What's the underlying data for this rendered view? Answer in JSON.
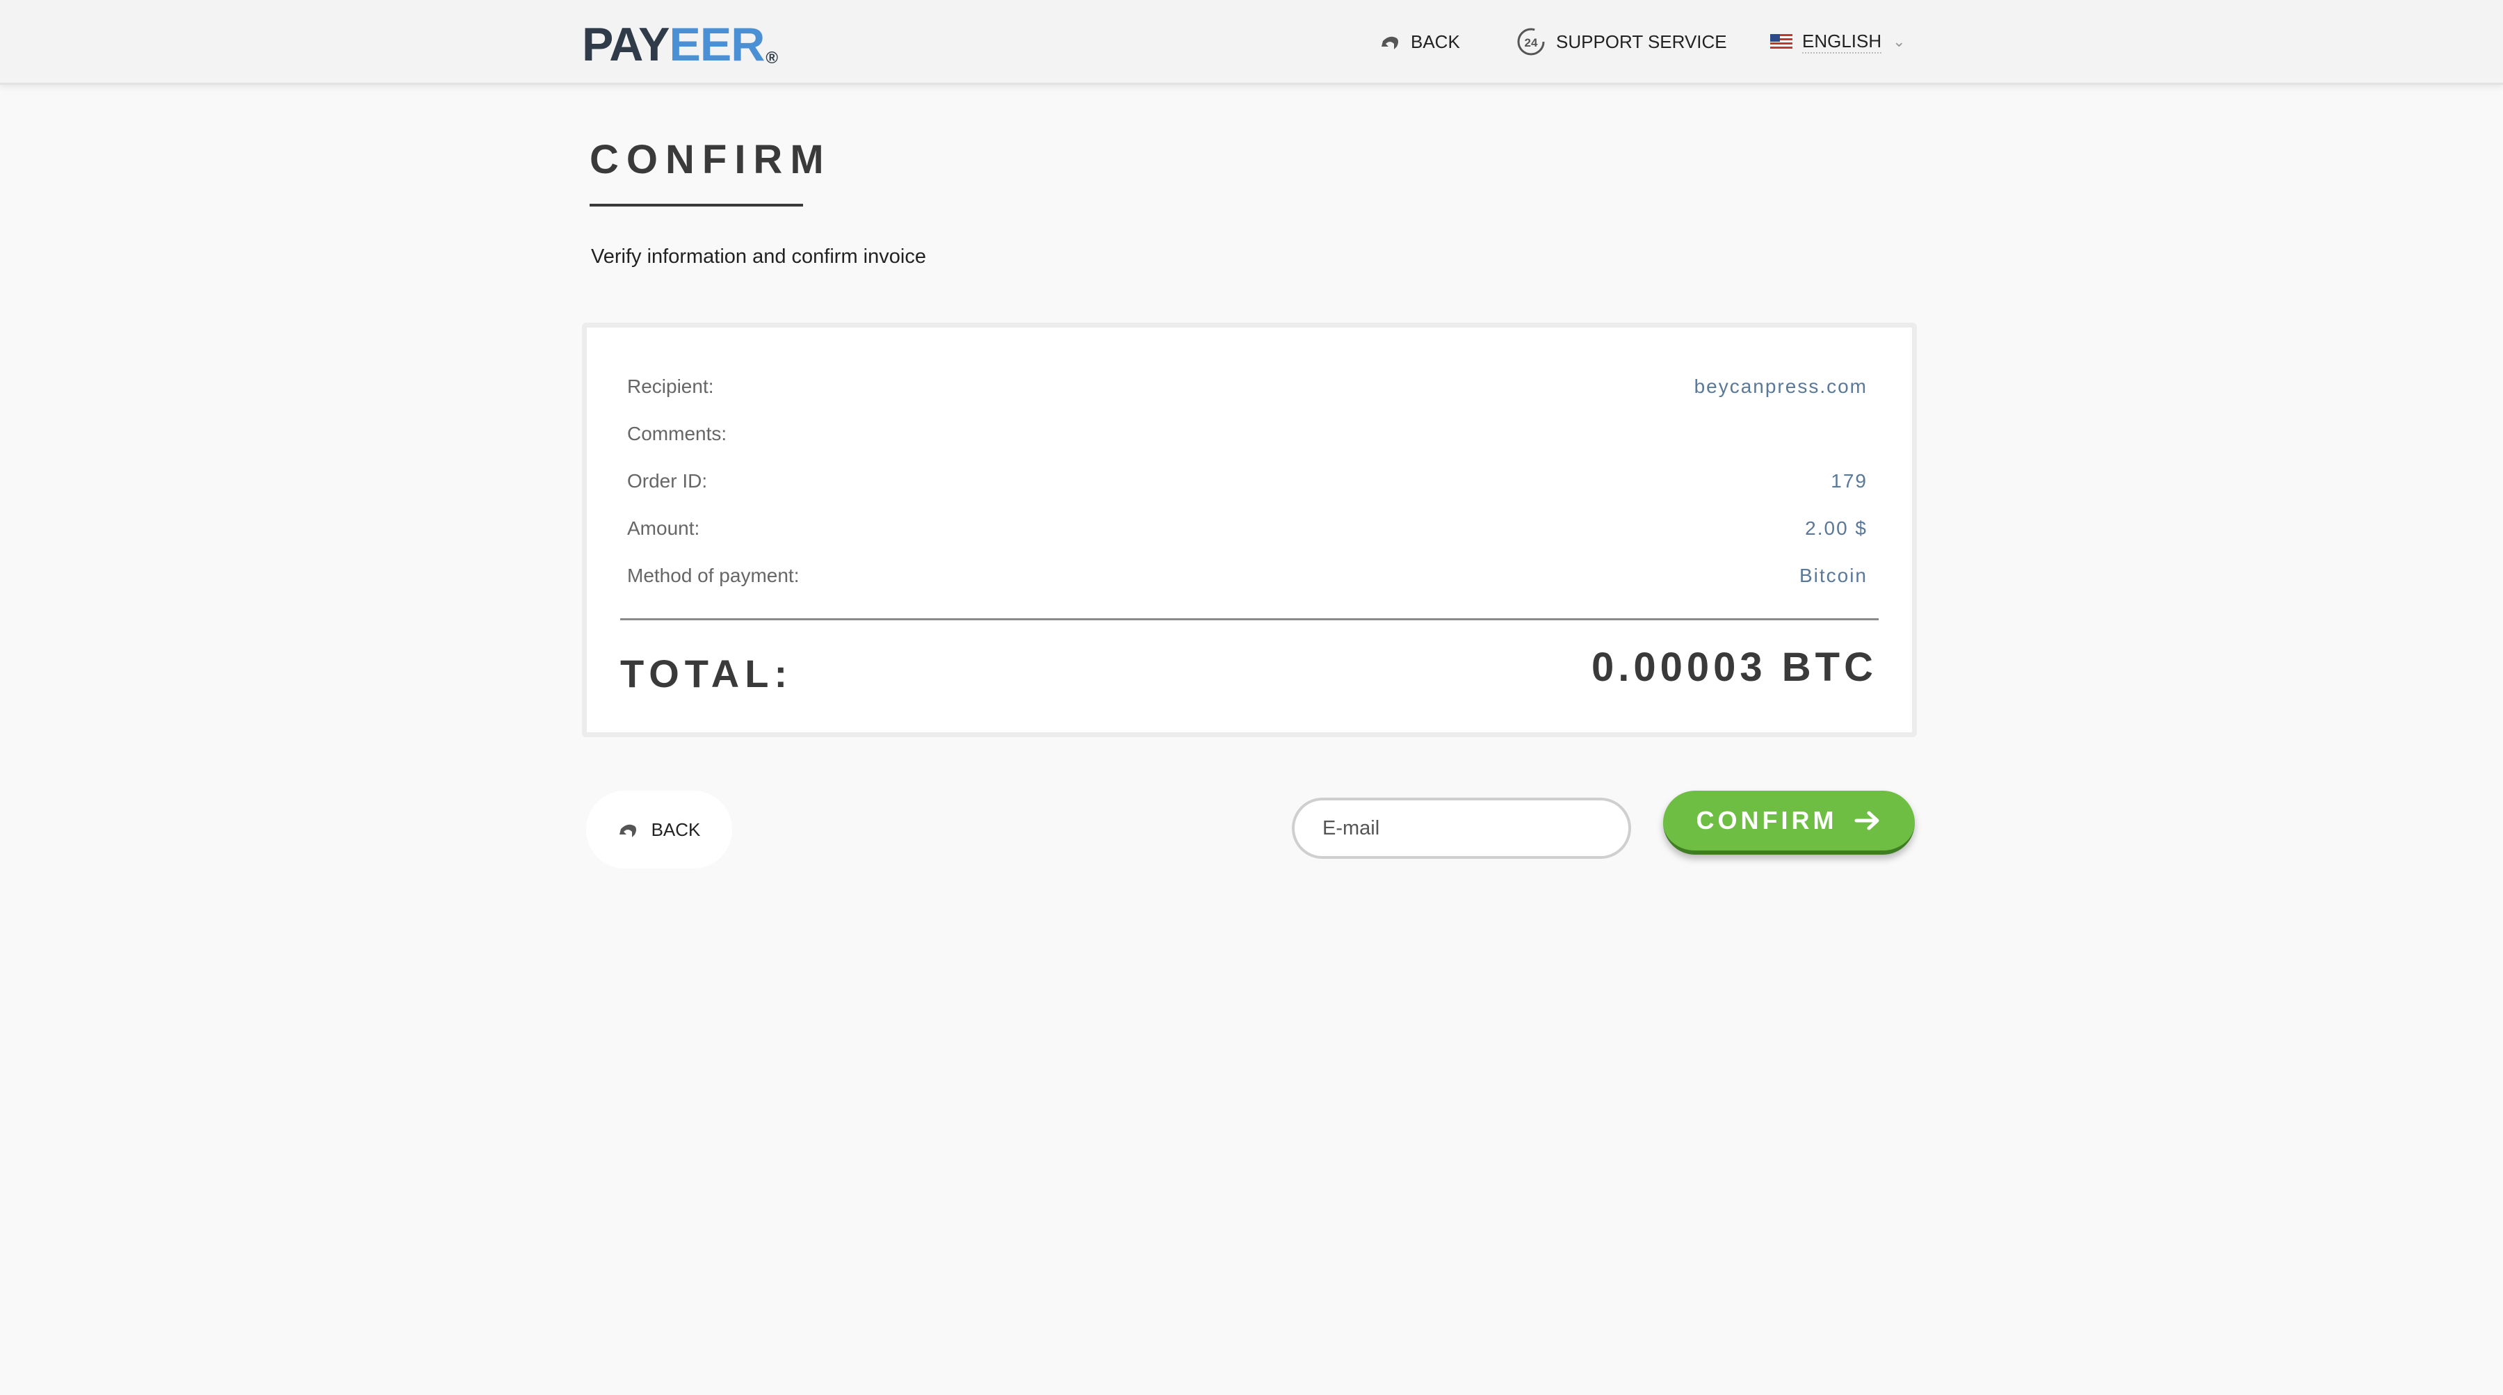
{
  "header": {
    "logo_part1": "PAY",
    "logo_part2": "EER",
    "logo_reg": "®",
    "back_label": "BACK",
    "support_label": "SUPPORT SERVICE",
    "language_label": "ENGLISH",
    "chevron": "⌄"
  },
  "page": {
    "title": "CONFIRM",
    "subtitle": "Verify information and confirm invoice"
  },
  "invoice": {
    "rows": [
      {
        "label": "Recipient:",
        "value": "beycanpress.com"
      },
      {
        "label": "Comments:",
        "value": ""
      },
      {
        "label": "Order ID:",
        "value": "179"
      },
      {
        "label": "Amount:",
        "value": "2.00 $"
      },
      {
        "label": "Method of payment:",
        "value": "Bitcoin"
      }
    ],
    "total_label": "TOTAL:",
    "total_value": "0.00003 BTC"
  },
  "actions": {
    "back_label": "BACK",
    "email_placeholder": "E-mail",
    "confirm_label": "CONFIRM"
  },
  "colors": {
    "accent_green": "#6fbe44",
    "logo_blue": "#4b90d5",
    "value_blue": "#5a7898"
  },
  "icons": [
    "back-arrow-icon",
    "support-24-icon",
    "us-flag-icon",
    "chevron-down-icon",
    "arrow-right-icon"
  ]
}
